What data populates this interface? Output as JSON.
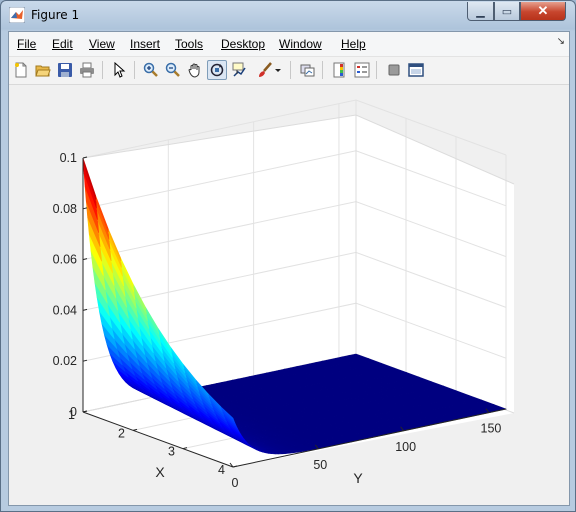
{
  "window": {
    "title": "Figure 1"
  },
  "menu": [
    "File",
    "Edit",
    "View",
    "Insert",
    "Tools",
    "Desktop",
    "Window",
    "Help"
  ],
  "toolbar_icons": [
    "new-figure-icon",
    "open-file-icon",
    "save-icon",
    "print-icon",
    "pointer-icon",
    "zoom-in-icon",
    "zoom-out-icon",
    "pan-icon",
    "rotate-3d-icon",
    "data-cursor-icon",
    "brush-icon",
    "brush-dropdown-icon",
    "link-plot-icon",
    "colorbar-icon",
    "legend-icon",
    "hide-plot-tools-icon",
    "show-plot-tools-icon"
  ],
  "chart_data": {
    "type": "surface",
    "colormap": "jet",
    "x_ticks": [
      "1",
      "2",
      "3",
      "4"
    ],
    "y_ticks": [
      "0",
      "50",
      "100",
      "150"
    ],
    "z_ticks": [
      "0",
      "0.02",
      "0.04",
      "0.06",
      "0.08",
      "0.1"
    ],
    "xlabel": "X",
    "ylabel": "Y",
    "xlim": [
      1,
      4
    ],
    "ylim": [
      0,
      160
    ],
    "zlim": [
      0,
      0.1
    ],
    "grid": true,
    "peak": {
      "x": 1,
      "y": 0,
      "z": 0.1
    },
    "description_values": {
      "z_at_x1": [
        0.1,
        0.061,
        0.037,
        0.022,
        0.014,
        0.008,
        0.005,
        0.003,
        0.002,
        0.001,
        0.0,
        0.0
      ],
      "y_samples": [
        0,
        5,
        10,
        15,
        20,
        25,
        30,
        40,
        50,
        75,
        100,
        160
      ]
    }
  }
}
